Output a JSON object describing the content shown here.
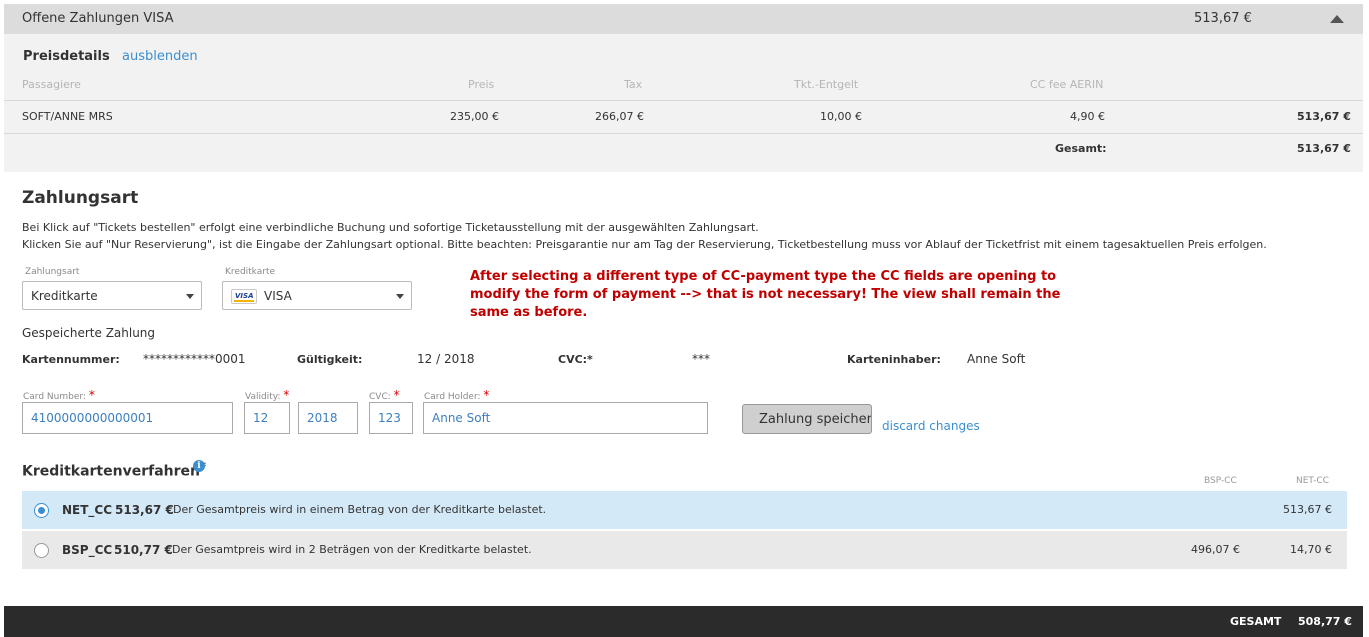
{
  "header": {
    "title": "Offene Zahlungen VISA",
    "amount": "513,67 €"
  },
  "price_details": {
    "title": "Preisdetails",
    "toggle_link": "ausblenden",
    "columns": [
      "Passagiere",
      "Preis",
      "Tax",
      "Tkt.-Entgelt",
      "CC fee AERIN"
    ],
    "row": {
      "passenger": "SOFT/ANNE MRS",
      "price": "235,00 €",
      "tax": "266,07 €",
      "ticket_fee": "10,00 €",
      "cc_fee": "4,90 €",
      "total": "513,67 €"
    },
    "total_label": "Gesamt:",
    "total_value": "513,67 €"
  },
  "payment": {
    "title": "Zahlungsart",
    "info_line1": "Bei Klick auf \"Tickets bestellen\" erfolgt eine verbindliche Buchung und sofortige Ticketausstellung mit der ausgewählten Zahlungsart.",
    "info_line2": "Klicken Sie auf \"Nur Reservierung\", ist die Eingabe der Zahlungsart optional. Bitte beachten: Preisgarantie nur am Tag der Reservierung, Ticketbestellung muss vor Ablauf der Ticketfrist mit einem tagesaktuellen Preis erfolgen.",
    "type_label": "Zahlungsart",
    "type_value": "Kreditkarte",
    "card_label": "Kreditkarte",
    "card_value": "VISA",
    "visa_logo_text": "VISA",
    "annotation_line1": "After selecting a different type of CC-payment type the CC fields are opening to",
    "annotation_line2": "modify the form of payment --> that is not necessary!  The view shall remain the",
    "annotation_line3": "same as before.",
    "saved_title": "Gespeicherte Zahlung",
    "saved": {
      "number_label": "Kartennummer:",
      "number_value": "************0001",
      "validity_label": "Gültigkeit:",
      "validity_value": "12 / 2018",
      "cvc_label": "CVC:*",
      "cvc_value": "***",
      "holder_label": "Karteninhaber:",
      "holder_value": "Anne Soft"
    },
    "form": {
      "card_number_label": "Card Number:",
      "card_number_value": "4100000000000001",
      "validity_label": "Validity:",
      "month_value": "12",
      "year_value": "2018",
      "cvc_label": "CVC:",
      "cvc_value": "123",
      "holder_label": "Card Holder:",
      "holder_value": "Anne Soft",
      "required_mark": "*",
      "save_button": "Zahlung speichern",
      "discard_link": "discard changes"
    }
  },
  "procedure": {
    "title": "Kreditkartenverfahren",
    "required_mark": "*",
    "info_icon_glyph": "i",
    "col_bsp": "BSP-CC",
    "col_net": "NET-CC",
    "options": [
      {
        "code": "NET_CC",
        "amount": "513,67 €",
        "desc": "Der Gesamtpreis wird in einem Betrag von der Kreditkarte belastet.",
        "bsp": "",
        "net": "513,67 €",
        "selected": true
      },
      {
        "code": "BSP_CC",
        "amount": "510,77 €",
        "desc": "Der Gesamtpreis wird in 2 Beträgen von der Kreditkarte belastet.",
        "bsp": "496,07 €",
        "net": "14,70 €",
        "selected": false
      }
    ]
  },
  "footer": {
    "total_label": "GESAMT",
    "total_value": "508,77 €"
  }
}
